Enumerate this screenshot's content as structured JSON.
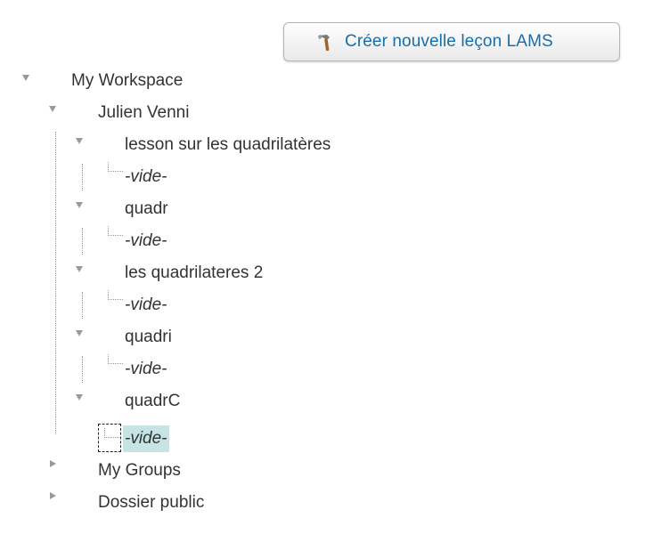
{
  "toolbar": {
    "create_lesson_label": "Créer nouvelle leçon LAMS",
    "accent_color": "#1a6ea8"
  },
  "tree": {
    "root": {
      "label": "My Workspace",
      "expanded": true
    },
    "user_folder": {
      "label": "Julien Venni",
      "expanded": true
    },
    "lessons": [
      {
        "label": "lesson sur les quadrilatères",
        "expanded": true,
        "child": "-vide-"
      },
      {
        "label": "quadr",
        "expanded": true,
        "child": "-vide-"
      },
      {
        "label": "les quadrilateres 2",
        "expanded": true,
        "child": "-vide-"
      },
      {
        "label": "quadri",
        "expanded": true,
        "child": "-vide-"
      },
      {
        "label": "quadrC",
        "expanded": true,
        "child": "-vide-",
        "child_selected": true
      }
    ],
    "groups": {
      "label": "My Groups",
      "expanded": false
    },
    "public": {
      "label": "Dossier public",
      "expanded": false
    }
  },
  "icons": {
    "toggle_open": "triangle-down-icon",
    "toggle_closed": "triangle-right-icon",
    "create": "hammer-icon"
  }
}
